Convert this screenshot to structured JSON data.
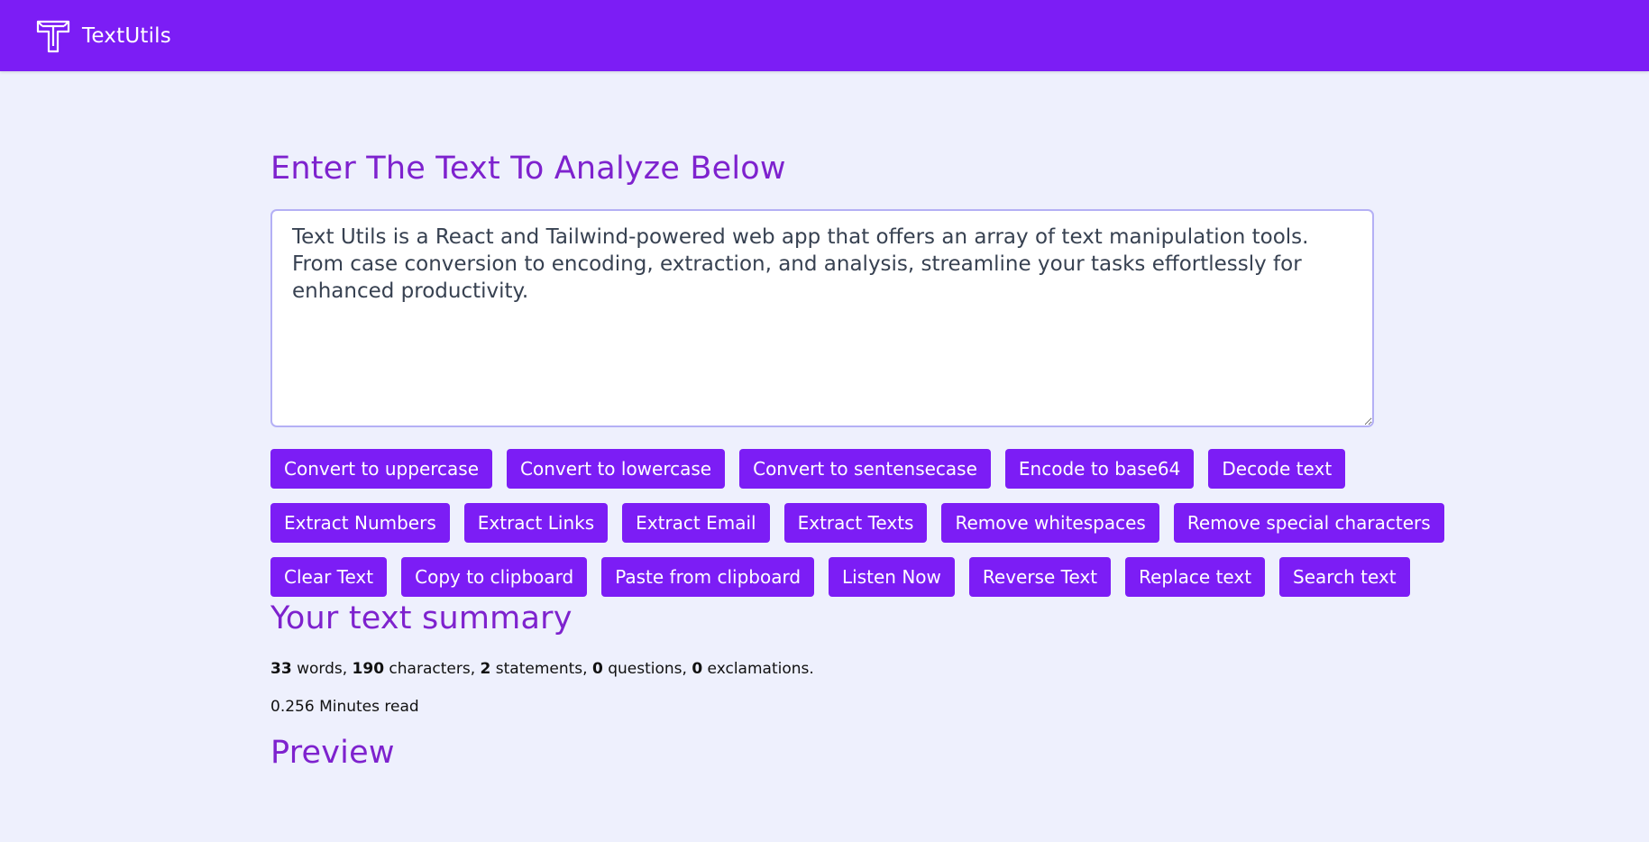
{
  "navbar": {
    "brand_name": "TextUtils",
    "background_color": "#7c1df5",
    "logo_icon": "t-logo-icon"
  },
  "main": {
    "heading": "Enter The Text To Analyze Below",
    "textarea_value": "Text Utils is a React and Tailwind-powered web app that offers an array of text manipulation tools. From case conversion to encoding, extraction, and analysis, streamline your tasks effortlessly for enhanced productivity."
  },
  "buttons": {
    "uppercase": "Convert to uppercase",
    "lowercase": "Convert to lowercase",
    "sentencecase": "Convert to sentensecase",
    "base64": "Encode to base64",
    "decode": "Decode text",
    "extract_numbers": "Extract Numbers",
    "extract_links": "Extract Links",
    "extract_email": "Extract Email",
    "extract_texts": "Extract Texts",
    "remove_whitespaces": "Remove whitespaces",
    "remove_special": "Remove special characters",
    "clear": "Clear Text",
    "copy": "Copy to clipboard",
    "paste": "Paste from clipboard",
    "listen": "Listen Now",
    "reverse": "Reverse Text",
    "replace": "Replace text",
    "search": "Search text"
  },
  "summary": {
    "title": "Your text summary",
    "words": "33",
    "words_label": " words, ",
    "characters": "190",
    "characters_label": " characters, ",
    "statements": "2",
    "statements_label": " statements, ",
    "questions": "0",
    "questions_label": " questions, ",
    "exclamations": "0",
    "exclamations_label": " exclamations.",
    "read_time": "0.256 Minutes read"
  },
  "preview": {
    "title": "Preview"
  },
  "colors": {
    "accent": "#7c1df5",
    "heading": "#7e22ce",
    "page_background": "#eef0fd"
  }
}
